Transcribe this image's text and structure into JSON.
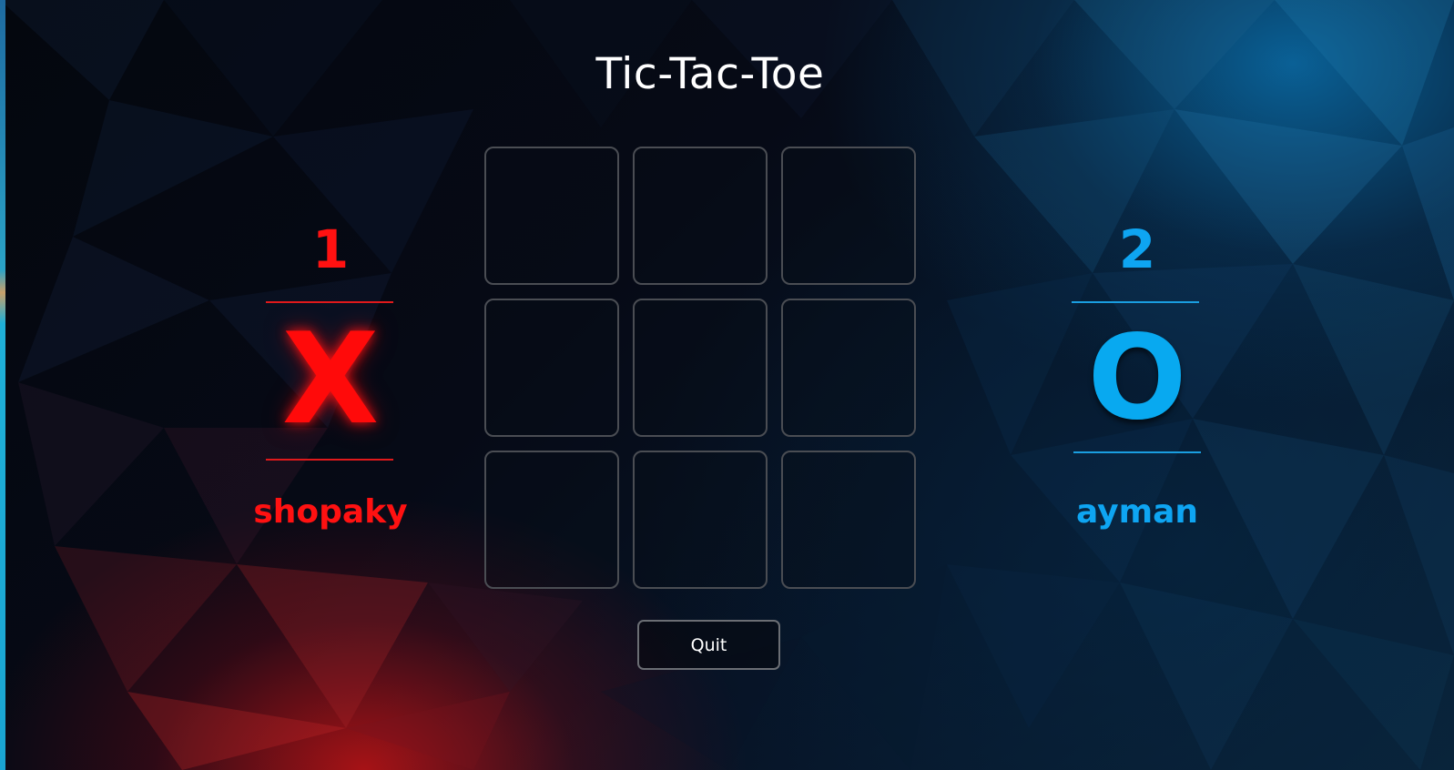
{
  "title": "Tic-Tac-Toe",
  "players": {
    "x": {
      "score": "1",
      "mark": "X",
      "name": "shopaky",
      "color": "#ff1111"
    },
    "o": {
      "score": "2",
      "mark": "O",
      "name": "ayman",
      "color": "#0aa3f0"
    }
  },
  "board": {
    "cells": [
      "",
      "",
      "",
      "",
      "",
      "",
      "",
      "",
      ""
    ]
  },
  "quit_label": "Quit"
}
